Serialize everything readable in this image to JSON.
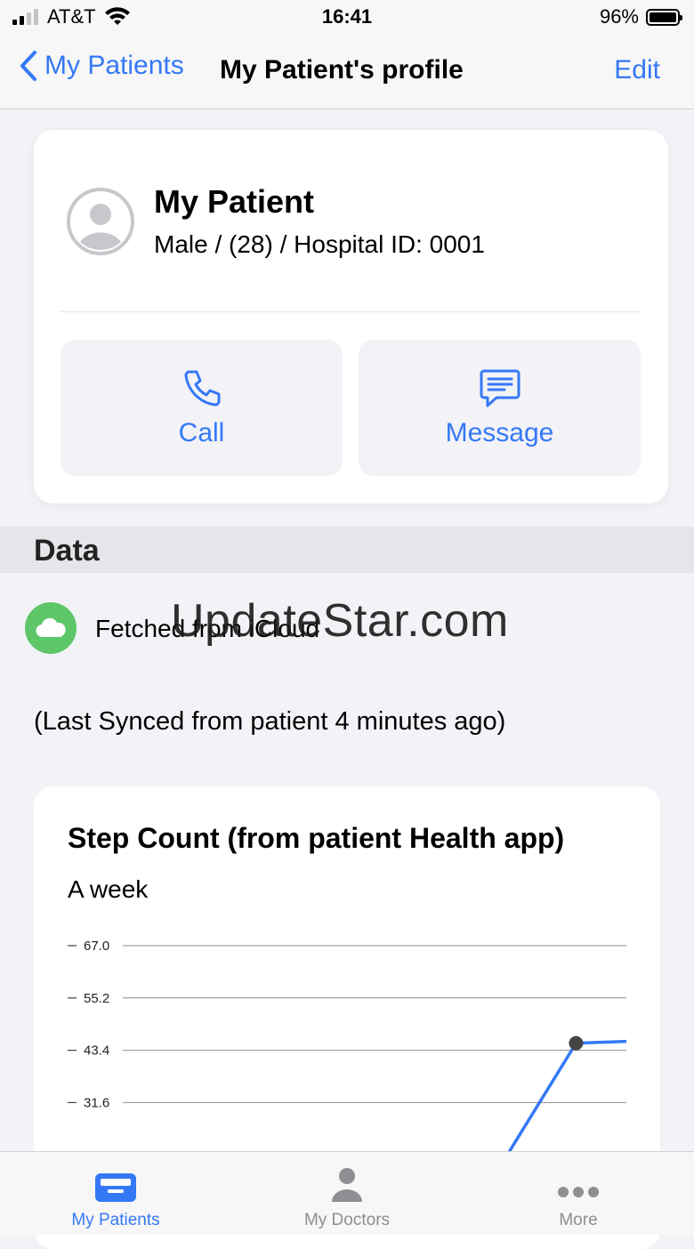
{
  "status_bar": {
    "carrier": "AT&T",
    "time": "16:41",
    "battery": "96%"
  },
  "nav": {
    "back_label": "My Patients",
    "title": "My Patient's profile",
    "edit_label": "Edit"
  },
  "patient": {
    "name": "My Patient",
    "info": "Male / (28) / Hospital ID: 0001"
  },
  "actions": {
    "call_label": "Call",
    "message_label": "Message"
  },
  "data_section": {
    "header": "Data",
    "fetched_label": "Fetched from iCloud",
    "watermark": "UpdateStar.com",
    "last_synced": "(Last Synced from patient  4 minutes ago)"
  },
  "chart": {
    "title": "Step Count (from patient Health app)",
    "subtitle": "A week"
  },
  "chart_data": {
    "type": "line",
    "title": "Step Count (from patient Health app)",
    "subtitle": "A week",
    "y_ticks": [
      "67.0",
      "55.2",
      "43.4",
      "31.6"
    ],
    "ylim": [
      19.8,
      67.0
    ],
    "grid": true,
    "series": [
      {
        "values": [
          {
            "x": 0.72,
            "y": 19.8
          },
          {
            "x": 0.9,
            "y": 45.0
          },
          {
            "x": 1.0,
            "y": 45.4
          }
        ],
        "color": "#3478f6",
        "marker_index": 1
      }
    ]
  },
  "tabs": [
    {
      "label": "My Patients",
      "icon": "tray-icon",
      "active": true
    },
    {
      "label": "My Doctors",
      "icon": "person-icon",
      "active": false
    },
    {
      "label": "More",
      "icon": "ellipsis-icon",
      "active": false
    }
  ],
  "colors": {
    "accent": "#3478f6",
    "cloud": "#5cc668",
    "background": "#f2f2f7"
  }
}
